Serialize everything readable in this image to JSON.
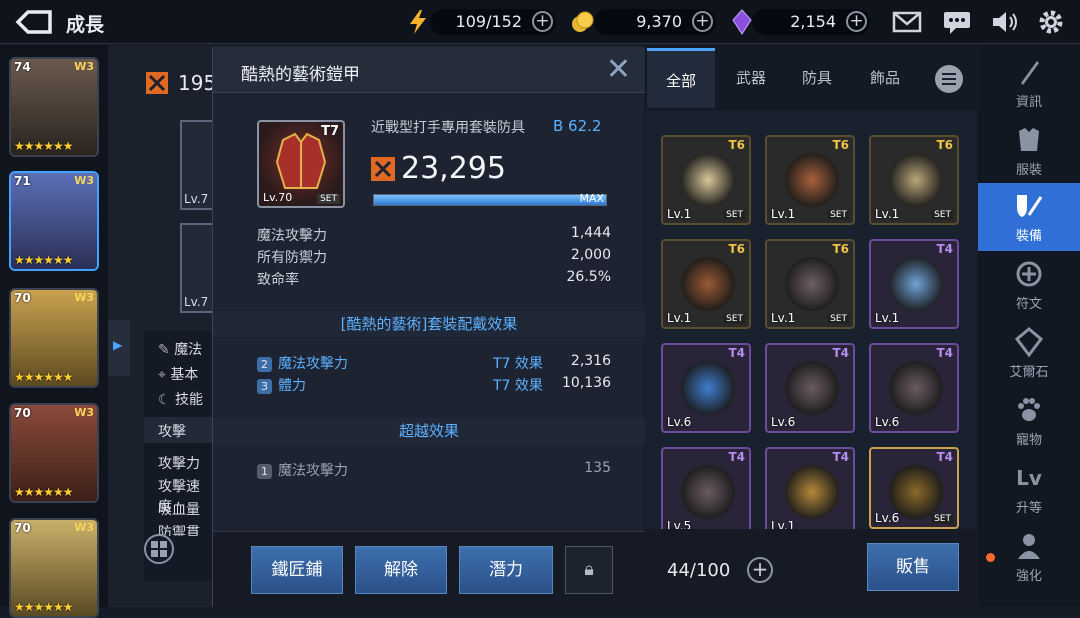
{
  "topbar": {
    "title": "成長",
    "stamina": "109/152",
    "gold": "9,370",
    "gems": "2,154"
  },
  "heroes": [
    {
      "level": "74",
      "badge": "W3",
      "stars": "★★★★★★",
      "color": "#6b5a4e"
    },
    {
      "level": "71",
      "badge": "W3",
      "stars": "★★★★★★",
      "color": "#5b6fb8"
    },
    {
      "level": "70",
      "badge": "W3",
      "stars": "★★★★★★",
      "color": "#c9a24f"
    },
    {
      "level": "70",
      "badge": "W3",
      "stars": "★★★★★★",
      "color": "#8a4a3a"
    },
    {
      "level": "70",
      "badge": "W3",
      "stars": "★★★★★★",
      "color": "#c9b06a"
    }
  ],
  "middle": {
    "power_partial": "195",
    "item_lv1": "Lv.7",
    "item_lv2": "Lv.7",
    "labels": [
      "魔法",
      "基本",
      "技能"
    ],
    "attack_header": "攻擊",
    "attack_rows": [
      "攻擊力",
      "攻擊速度",
      "吸血量",
      "防禦貫穿"
    ]
  },
  "modal": {
    "title": "酷熱的藝術鎧甲",
    "item": {
      "tier": "T7",
      "level": "Lv.70",
      "set": "SET"
    },
    "subtype": "近戰型打手專用套裝防具",
    "grade": "B 62.2",
    "power": "23,295",
    "max_label": "MAX",
    "progress": 1.0,
    "stats": [
      {
        "label": "魔法攻擊力",
        "value": "1,444"
      },
      {
        "label": "所有防禦力",
        "value": "2,000"
      },
      {
        "label": "致命率",
        "value": "26.5%"
      }
    ],
    "set_header": "[酷熱的藝術]套裝配戴效果",
    "set_effects": [
      {
        "num": "2",
        "label": "魔法攻擊力",
        "effect": "T7 效果",
        "value": "2,316"
      },
      {
        "num": "3",
        "label": "體力",
        "effect": "T7 效果",
        "value": "10,136"
      }
    ],
    "trans_header": "超越效果",
    "trans_effects": [
      {
        "num": "1",
        "label": "魔法攻擊力",
        "value": "135"
      }
    ],
    "buttons": {
      "smith": "鐵匠鋪",
      "unequip": "解除",
      "potential": "潛力"
    }
  },
  "inventory": {
    "tabs": [
      "全部",
      "武器",
      "防具",
      "飾品"
    ],
    "items": [
      {
        "tier": "T6",
        "level": "Lv.1",
        "set": "SET",
        "rarity": "gold",
        "color": "#d8c79a"
      },
      {
        "tier": "T6",
        "level": "Lv.1",
        "set": "SET",
        "rarity": "gold",
        "color": "#a8603a"
      },
      {
        "tier": "T6",
        "level": "Lv.1",
        "set": "SET",
        "rarity": "gold",
        "color": "#b9a679"
      },
      {
        "tier": "T6",
        "level": "Lv.1",
        "set": "SET",
        "rarity": "gold",
        "color": "#9a5a33"
      },
      {
        "tier": "T6",
        "level": "Lv.1",
        "set": "SET",
        "rarity": "gold",
        "color": "#6e5f63"
      },
      {
        "tier": "T4",
        "level": "Lv.1",
        "set": "",
        "rarity": "purple",
        "color": "#6fa3d8"
      },
      {
        "tier": "T4",
        "level": "Lv.6",
        "set": "",
        "rarity": "purple",
        "color": "#3f7fd0"
      },
      {
        "tier": "T4",
        "level": "Lv.6",
        "set": "",
        "rarity": "purple",
        "color": "#6a5b63"
      },
      {
        "tier": "T4",
        "level": "Lv.6",
        "set": "",
        "rarity": "purple",
        "color": "#6a5b63"
      },
      {
        "tier": "T4",
        "level": "Lv.5",
        "set": "",
        "rarity": "purple",
        "color": "#6a5b63"
      },
      {
        "tier": "T4",
        "level": "Lv.1",
        "set": "",
        "rarity": "purple",
        "color": "#b58a3a"
      },
      {
        "tier": "T4",
        "level": "Lv.6",
        "set": "SET",
        "rarity": "purple",
        "color": "#8a6a2a"
      }
    ],
    "capacity": "44/100",
    "sell": "販售"
  },
  "sidebar": [
    {
      "label": "資訊",
      "icon": "sword-icon"
    },
    {
      "label": "服裝",
      "icon": "outfit-icon"
    },
    {
      "label": "裝備",
      "icon": "equipment-icon",
      "active": true
    },
    {
      "label": "符文",
      "icon": "rune-icon"
    },
    {
      "label": "艾爾石",
      "icon": "elstone-icon"
    },
    {
      "label": "寵物",
      "icon": "pet-icon"
    },
    {
      "label": "升等",
      "icon": "levelup-icon"
    },
    {
      "label": "強化",
      "icon": "enhance-icon"
    }
  ]
}
